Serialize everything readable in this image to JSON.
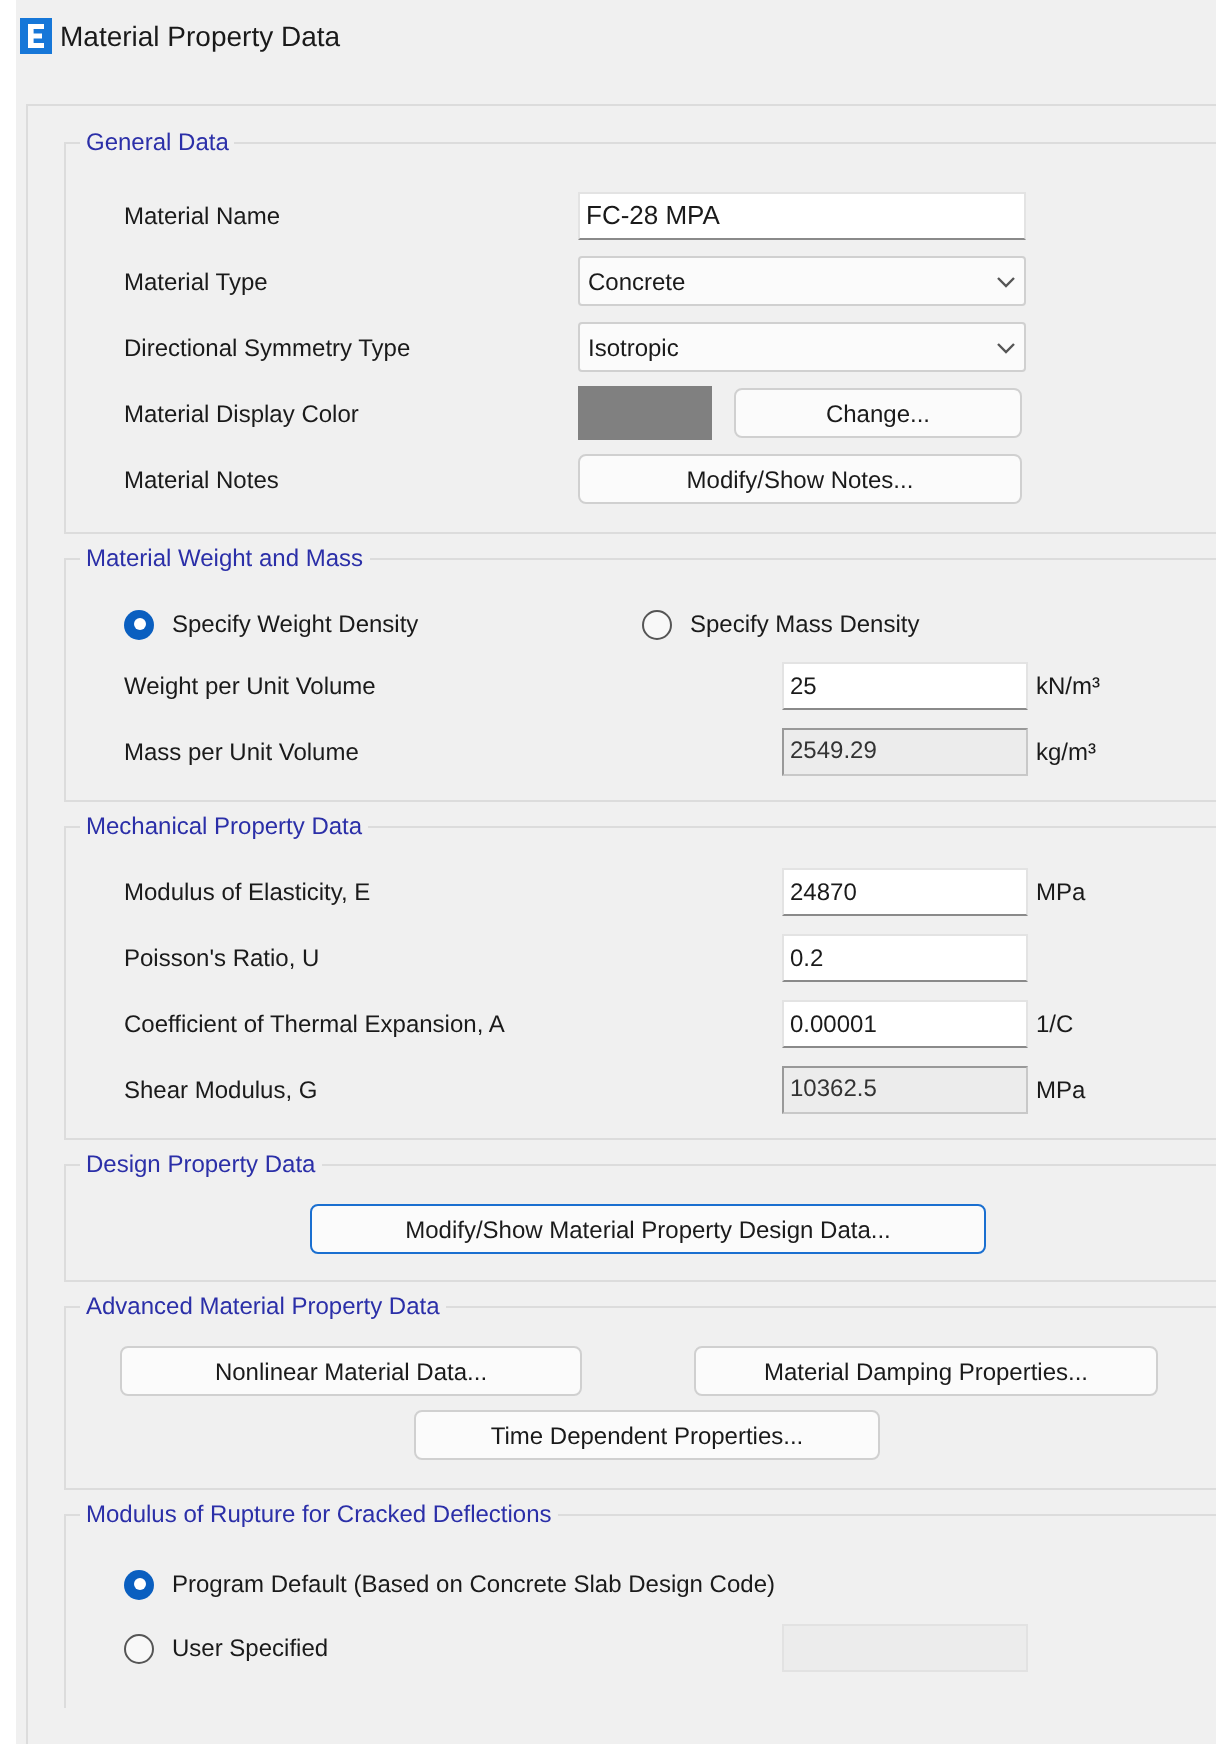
{
  "window": {
    "title": "Material Property Data"
  },
  "general_data": {
    "title": "General Data",
    "rows": [
      {
        "kind": "text",
        "label": "Material Name",
        "value": "FC-28 MPA"
      },
      {
        "kind": "dropdown",
        "label": "Material Type",
        "value": "Concrete"
      },
      {
        "kind": "dropdown",
        "label": "Directional Symmetry Type",
        "value": "Isotropic"
      },
      {
        "kind": "color",
        "label": "Material Display Color",
        "color": "#808080",
        "button": "Change..."
      },
      {
        "kind": "button",
        "label": "Material Notes",
        "button": "Modify/Show Notes..."
      }
    ]
  },
  "weight_mass": {
    "title": "Material Weight and Mass",
    "options": [
      {
        "label": "Specify Weight Density",
        "selected": true
      },
      {
        "label": "Specify Mass Density",
        "selected": false
      }
    ],
    "fields": [
      {
        "label": "Weight per Unit Volume",
        "value": "25",
        "unit": "kN/m³",
        "disabled": false
      },
      {
        "label": "Mass per Unit Volume",
        "value": "2549.29",
        "unit": "kg/m³",
        "disabled": true
      }
    ]
  },
  "mechanical": {
    "title": "Mechanical Property Data",
    "fields": [
      {
        "label": "Modulus of Elasticity,  E",
        "value": "24870",
        "unit": "MPa",
        "disabled": false
      },
      {
        "label": "Poisson's Ratio,  U",
        "value": "0.2",
        "disabled": false
      },
      {
        "label": "Coefficient of Thermal Expansion,  A",
        "value": "0.00001",
        "unit": "1/C",
        "disabled": false
      },
      {
        "label": "Shear Modulus,  G",
        "value": "10362.5",
        "unit": "MPa",
        "disabled": true
      }
    ]
  },
  "design": {
    "title": "Design Property Data",
    "button": {
      "label": "Modify/Show Material Property Design Data...",
      "focused": true
    }
  },
  "advanced": {
    "title": "Advanced Material Property Data",
    "buttons": [
      "Nonlinear Material Data...",
      "Material Damping Properties...",
      "Time Dependent Properties..."
    ]
  },
  "rupture": {
    "title": "Modulus of Rupture for Cracked Deflections",
    "options": [
      {
        "label": "Program Default  (Based on Concrete Slab Design Code)",
        "selected": true
      },
      {
        "label": "User Specified",
        "selected": false
      }
    ],
    "user_field": {
      "disabled": true
    }
  }
}
